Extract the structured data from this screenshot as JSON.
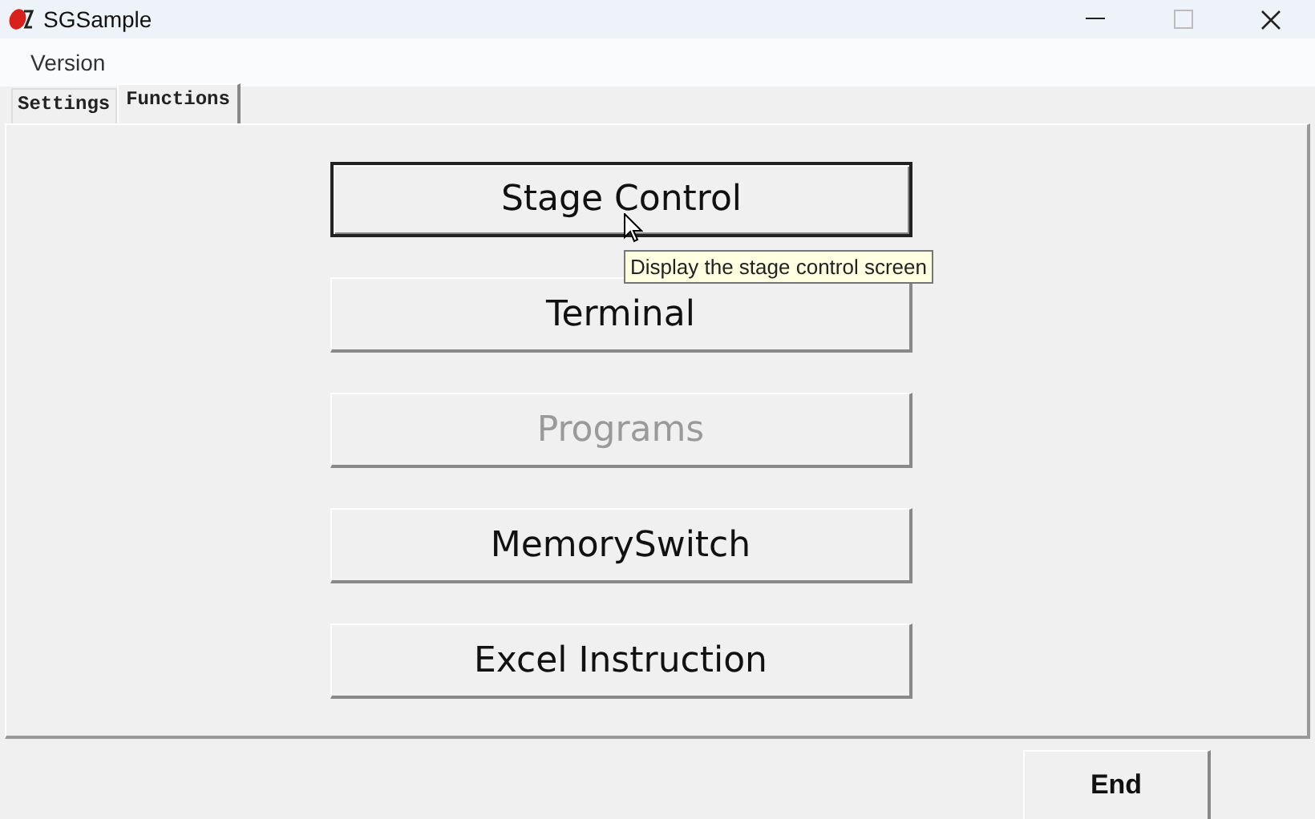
{
  "window": {
    "title": "SGSample"
  },
  "menu": [
    "Version"
  ],
  "tabs": [
    {
      "label": "Settings",
      "selected": false
    },
    {
      "label": "Functions",
      "selected": true
    }
  ],
  "buttons": [
    {
      "label": "Stage Control",
      "disabled": false,
      "focused": true
    },
    {
      "label": "Terminal",
      "disabled": false,
      "focused": false
    },
    {
      "label": "Programs",
      "disabled": true,
      "focused": false
    },
    {
      "label": "MemorySwitch",
      "disabled": false,
      "focused": false
    },
    {
      "label": "Excel Instruction",
      "disabled": false,
      "focused": false
    }
  ],
  "tooltip": "Display the stage control screen",
  "end_button": "End"
}
